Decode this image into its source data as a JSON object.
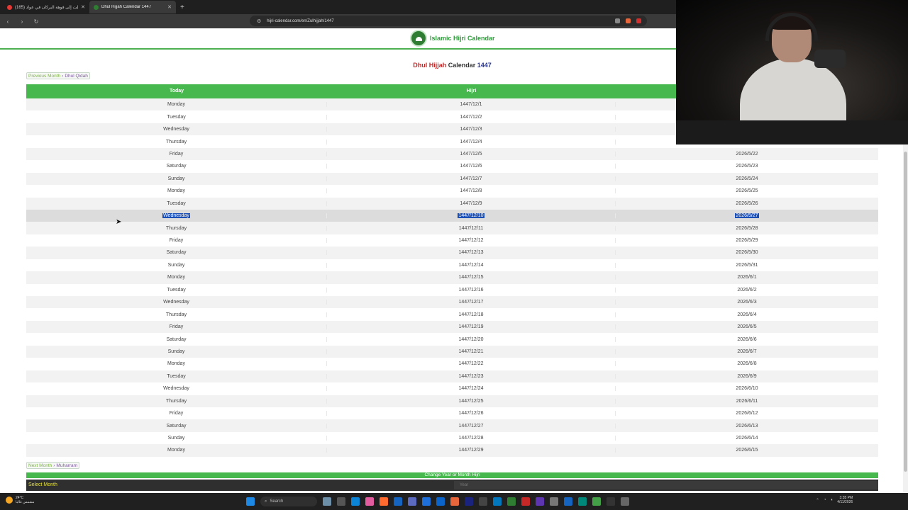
{
  "browser": {
    "tabs": [
      {
        "title": "(165) وصلت إلى فوهة البركان في عواد"
      },
      {
        "title": "Dhul Hijjah Calendar 1447"
      }
    ],
    "url": "hijri-calendar.com/en/Zulhijjah/1447"
  },
  "site": {
    "name": "Islamic Hijri Calendar"
  },
  "page": {
    "title_month": "Dhul Hijjah",
    "title_word": "Calendar",
    "title_year": "1447",
    "prev_text": "Previous Month",
    "prev_month": "Dhul Qidah",
    "next_text": "Next Month",
    "next_month": "Muharram",
    "change_bar": "Change Year or Month Hijri",
    "select_month": "Select Month",
    "year_placeholder": "Year"
  },
  "table": {
    "headers": [
      "Today",
      "Hijri",
      ""
    ],
    "selected_row": 9,
    "rows": [
      [
        "Monday",
        "1447/12/1",
        ""
      ],
      [
        "Tuesday",
        "1447/12/2",
        ""
      ],
      [
        "Wednesday",
        "1447/12/3",
        ""
      ],
      [
        "Thursday",
        "1447/12/4",
        ""
      ],
      [
        "Friday",
        "1447/12/5",
        "2026/5/22"
      ],
      [
        "Saturday",
        "1447/12/6",
        "2026/5/23"
      ],
      [
        "Sunday",
        "1447/12/7",
        "2026/5/24"
      ],
      [
        "Monday",
        "1447/12/8",
        "2026/5/25"
      ],
      [
        "Tuesday",
        "1447/12/9",
        "2026/5/26"
      ],
      [
        "Wednesday",
        "1447/12/10",
        "2026/5/27"
      ],
      [
        "Thursday",
        "1447/12/11",
        "2026/5/28"
      ],
      [
        "Friday",
        "1447/12/12",
        "2026/5/29"
      ],
      [
        "Saturday",
        "1447/12/13",
        "2026/5/30"
      ],
      [
        "Sunday",
        "1447/12/14",
        "2026/5/31"
      ],
      [
        "Monday",
        "1447/12/15",
        "2026/6/1"
      ],
      [
        "Tuesday",
        "1447/12/16",
        "2026/6/2"
      ],
      [
        "Wednesday",
        "1447/12/17",
        "2026/6/3"
      ],
      [
        "Thursday",
        "1447/12/18",
        "2026/6/4"
      ],
      [
        "Friday",
        "1447/12/19",
        "2026/6/5"
      ],
      [
        "Saturday",
        "1447/12/20",
        "2026/6/6"
      ],
      [
        "Sunday",
        "1447/12/21",
        "2026/6/7"
      ],
      [
        "Monday",
        "1447/12/22",
        "2026/6/8"
      ],
      [
        "Tuesday",
        "1447/12/23",
        "2026/6/9"
      ],
      [
        "Wednesday",
        "1447/12/24",
        "2026/6/10"
      ],
      [
        "Thursday",
        "1447/12/25",
        "2026/6/11"
      ],
      [
        "Friday",
        "1447/12/26",
        "2026/6/12"
      ],
      [
        "Saturday",
        "1447/12/27",
        "2026/6/13"
      ],
      [
        "Sunday",
        "1447/12/28",
        "2026/6/14"
      ],
      [
        "Monday",
        "1447/12/29",
        "2026/6/15"
      ]
    ]
  },
  "taskbar": {
    "weather_temp": "24°C",
    "weather_desc": "مشمس غالبا",
    "search": "Search",
    "time": "3:35 PM",
    "date": "4/11/2026"
  },
  "colors": {
    "accent": "#46b84e",
    "selection": "#1a4fb8",
    "title_month": "#c62828",
    "title_year": "#283593"
  }
}
